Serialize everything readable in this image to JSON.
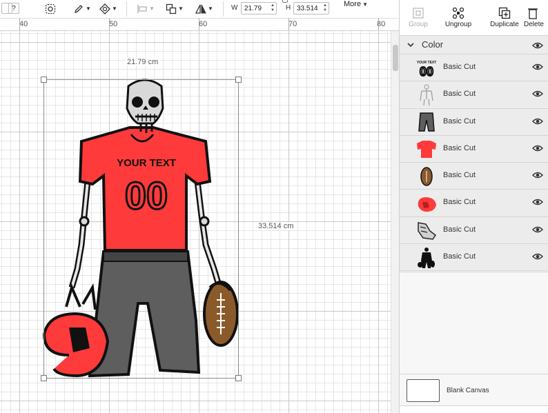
{
  "toolbar": {
    "help_label": "?",
    "width_label": "W",
    "width_value": "21.79",
    "height_label": "H",
    "height_value": "33.514",
    "more_label": "More"
  },
  "ruler": {
    "ticks": [
      "40",
      "50",
      "60",
      "70",
      "80"
    ]
  },
  "canvas": {
    "width_dimension": "21.79 cm",
    "height_dimension": "33.514 cm",
    "design": {
      "jersey_text": "YOUR TEXT",
      "jersey_number": "00"
    },
    "colors": {
      "jersey": "#ff3a3a",
      "pants": "#5e5e5e",
      "football": "#8b5a2b",
      "outline": "#111111"
    }
  },
  "panel": {
    "tools": [
      {
        "label": "Group",
        "icon": "group-icon",
        "enabled": false
      },
      {
        "label": "Ungroup",
        "icon": "ungroup-icon",
        "enabled": true
      },
      {
        "label": "Duplicate",
        "icon": "duplicate-icon",
        "enabled": true
      },
      {
        "label": "Delete",
        "icon": "delete-icon",
        "enabled": true
      }
    ],
    "group": {
      "label": "Color"
    },
    "layers": [
      {
        "label": "Basic Cut",
        "thumb_text": "YOUR TEXT",
        "thumb_number": "00",
        "thumb": "text-thumbnail"
      },
      {
        "label": "Basic Cut",
        "thumb": "skeleton-thumbnail"
      },
      {
        "label": "Basic Cut",
        "thumb": "pants-thumbnail"
      },
      {
        "label": "Basic Cut",
        "thumb": "jersey-thumbnail"
      },
      {
        "label": "Basic Cut",
        "thumb": "football-thumbnail"
      },
      {
        "label": "Basic Cut",
        "thumb": "helmet-thumbnail"
      },
      {
        "label": "Basic Cut",
        "thumb": "shoes-thumbnail"
      },
      {
        "label": "Basic Cut",
        "thumb": "silhouette-thumbnail"
      }
    ],
    "blank_canvas_label": "Blank Canvas"
  }
}
